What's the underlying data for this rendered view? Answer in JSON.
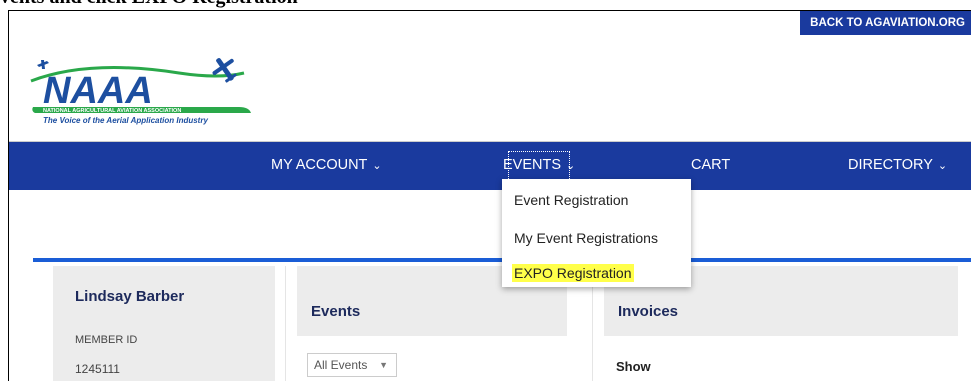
{
  "doc_heading": "vents and click EXPO Registration",
  "header": {
    "back_link": "BACK TO AGAVIATION.ORG",
    "logo": {
      "text": "NAAA",
      "subtitle": "NATIONAL AGRICULTURAL AVIATION ASSOCIATION",
      "tagline": "The Voice of the Aerial Application Industry"
    }
  },
  "nav": {
    "items": [
      {
        "label": "MY ACCOUNT"
      },
      {
        "label": "EVENTS"
      },
      {
        "label": "CART"
      },
      {
        "label": "DIRECTORY"
      }
    ]
  },
  "dropdown": {
    "items": [
      {
        "label": "Event Registration"
      },
      {
        "label": "My Event Registrations"
      },
      {
        "label": "EXPO Registration",
        "highlighted": true
      }
    ]
  },
  "profile": {
    "name": "Lindsay Barber",
    "member_id_label": "MEMBER ID",
    "member_id": "1245111"
  },
  "events_panel": {
    "title": "Events",
    "filter_value": "All Events"
  },
  "invoices_panel": {
    "title": "Invoices",
    "show_label": "Show"
  },
  "colors": {
    "brand_blue": "#1a3a9e",
    "accent_blue": "#1a5dd6",
    "logo_green": "#2aa84a",
    "highlight": "#ffff4a"
  }
}
